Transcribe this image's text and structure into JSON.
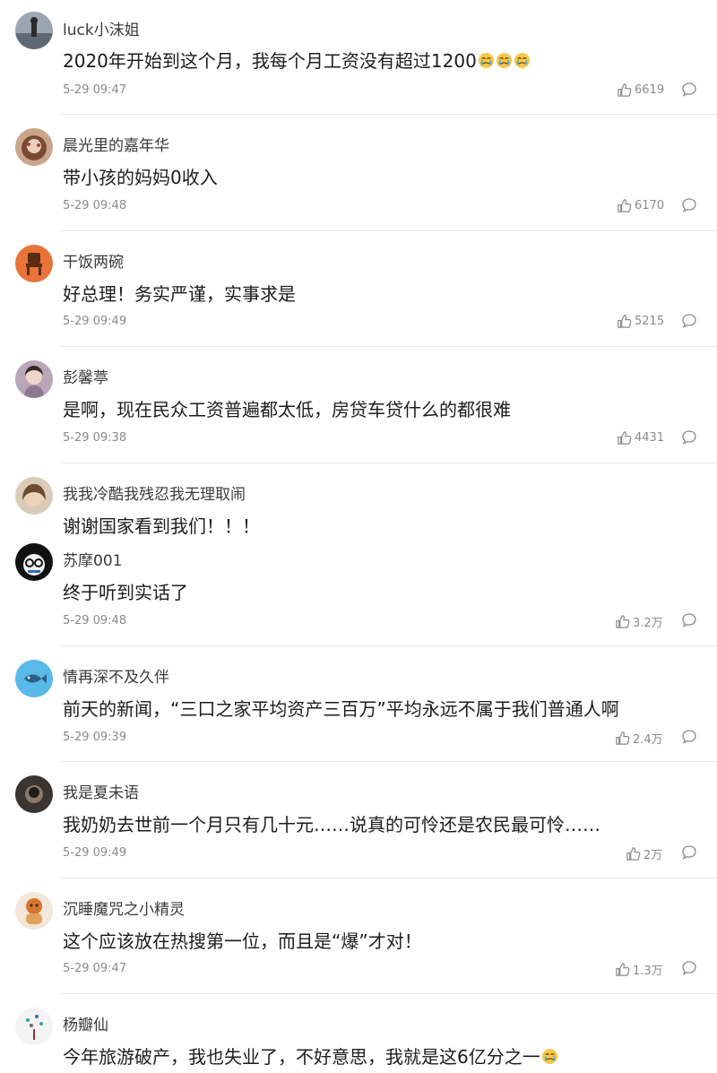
{
  "comments": [
    {
      "user": "luck小沫姐",
      "text": "2020年开始到这个月，我每个月工资没有超过1200",
      "emoji_count": 3,
      "time": "5-29 09:47",
      "likes": "6619",
      "avatar": "avatar-photo-person-by-water"
    },
    {
      "user": "晨光里的嘉年华",
      "text": "带小孩的妈妈0收入",
      "time": "5-29 09:48",
      "likes": "6170",
      "avatar": "avatar-photo-cake"
    },
    {
      "user": "干饭两碗",
      "text": "好总理！务实严谨，实事求是",
      "time": "5-29 09:49",
      "likes": "5215",
      "avatar": "avatar-chair-icon-orange"
    },
    {
      "user": "彭馨葶",
      "text": "是啊，现在民众工资普遍都太低，房贷车贷什么的都很难",
      "time": "5-29 09:38",
      "likes": "4431",
      "avatar": "avatar-photo-girl"
    },
    {
      "user": "我我冷酷我残忍我无理取闹",
      "text": "谢谢国家看到我们！！！",
      "avatar": "avatar-photo-woman"
    },
    {
      "user": "苏摩001",
      "text": "终于听到实话了",
      "time": "5-29 09:48",
      "likes": "3.2万",
      "avatar": "avatar-cartoon-glasses"
    },
    {
      "user": "情再深不及久伴",
      "text": "前天的新闻，“三口之家平均资产三百万”平均永远不属于我们普通人啊",
      "time": "5-29 09:39",
      "likes": "2.4万",
      "avatar": "avatar-fish-icon-blue"
    },
    {
      "user": "我是夏未语",
      "text": "我奶奶去世前一个月只有几十元……说真的可怜还是农民最可怜……",
      "time": "5-29 09:49",
      "likes": "2万",
      "avatar": "avatar-photo-dark"
    },
    {
      "user": "沉睡魔咒之小精灵",
      "text": "这个应该放在热搜第一位，而且是“爆”才对！",
      "time": "5-29 09:47",
      "likes": "1.3万",
      "avatar": "avatar-photo-figurine"
    },
    {
      "user": "杨瓣仙",
      "text": "今年旅游破产，我也失业了，不好意思，我就是这6亿分之一",
      "emoji_count": 1,
      "avatar": "avatar-sparkle-icon"
    }
  ],
  "icons": {
    "like": "thumbs-up-icon",
    "reply": "comment-bubble-icon",
    "emoji": "crying-face-emoji"
  },
  "colors": {
    "meta": "#8a8a8a",
    "divider": "#e6e6e6",
    "text": "#1c1c1c"
  }
}
